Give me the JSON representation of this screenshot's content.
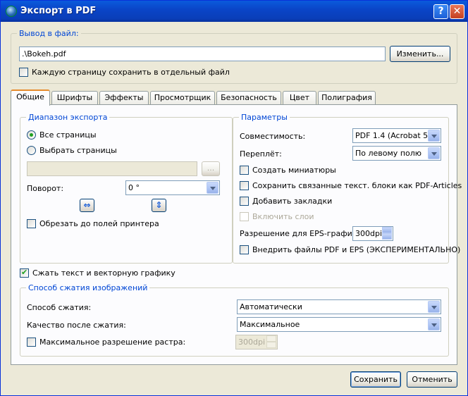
{
  "window": {
    "title": "Экспорт в PDF",
    "help_label": "?",
    "close_label": "✕",
    "app_icon": "scribus-icon"
  },
  "output": {
    "group_label": "Вывод в файл:",
    "file_value": ".\\Bokeh.pdf",
    "change_button": "Изменить...",
    "separate_pages_label": "Каждую страницу сохранить в отдельный файл",
    "separate_pages_checked": false
  },
  "tabs": [
    "Общие",
    "Шрифты",
    "Эффекты",
    "Просмотрщик",
    "Безопасность",
    "Цвет",
    "Полиграфия"
  ],
  "active_tab": "Общие",
  "export_range": {
    "group_label": "Диапазон экспорта",
    "all_pages_label": "Все страницы",
    "select_pages_label": "Выбрать страницы",
    "selected": "all_pages",
    "browse_label": "...",
    "rotation_label": "Поворот:",
    "rotation_value": "0 °",
    "crop_label": "Обрезать до полей принтера",
    "crop_checked": false
  },
  "params": {
    "group_label": "Параметры",
    "compat_label": "Совместимость:",
    "compat_value": "PDF 1.4 (Acrobat 5)",
    "binding_label": "Переплёт:",
    "binding_value": "По левому полю",
    "thumbnails_label": "Создать миниатюры",
    "articles_label": "Сохранить связанные текст. блоки как PDF-Articles",
    "bookmarks_label": "Добавить закладки",
    "layers_label": "Включить слои",
    "eps_res_label": "Разрешение для EPS-графики:",
    "eps_res_value": "300dpi",
    "embed_label": "Внедрить файлы PDF и EPS (ЭКСПЕРИМЕНТАЛЬНО)"
  },
  "compress": {
    "label": "Сжать текст и векторную графику",
    "checked": true,
    "image_group_label": "Способ сжатия изображений",
    "method_label": "Способ сжатия:",
    "method_value": "Автоматически",
    "quality_label": "Качество после сжатия:",
    "quality_value": "Максимальное",
    "max_res_label": "Максимальное разрешение растра:",
    "max_res_value": "300dpi"
  },
  "buttons": {
    "save": "Сохранить",
    "cancel": "Отменить"
  }
}
